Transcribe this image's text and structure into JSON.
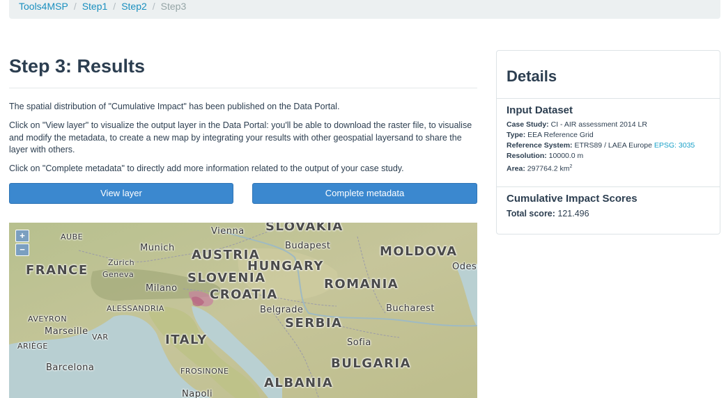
{
  "breadcrumb": {
    "items": [
      "Tools4MSP",
      "Step1",
      "Step2"
    ],
    "separator": "/",
    "current": "Step3"
  },
  "main": {
    "title": "Step 3: Results",
    "paragraphs": [
      "The spatial distribution of \"Cumulative Impact\" has been published on the Data Portal.",
      "Click on \"View layer\" to visualize the output layer in the Data Portal: you'll be able to download the raster file, to visualise and modify the metadata, to create a new map by integrating your results with other geospatial layersand to share the layer with others.",
      "Click on \"Complete metadata\" to directly add more information related to the output of your case study."
    ],
    "buttons": {
      "view_layer": "View layer",
      "complete_metadata": "Complete metadata"
    }
  },
  "map": {
    "zoom_in": "+",
    "zoom_out": "−",
    "labels": {
      "aube": "AUBE",
      "france": "FRANCE",
      "zurich": "Zurich",
      "geneva": "Geneva",
      "munich": "Munich",
      "vienna": "Vienna",
      "slovakia": "SLOVAKIA",
      "austria": "AUSTRIA",
      "budapest": "Budapest",
      "hungary": "HUNGARY",
      "moldova": "MOLDOVA",
      "odessa": "Odess",
      "slovenia": "SLOVENIA",
      "milano": "Milano",
      "croatia": "CROATIA",
      "romania": "ROMANIA",
      "alessandria": "ALESSANDRIA",
      "belgrade": "Belgrade",
      "bucharest": "Bucharest",
      "aveyron": "AVEYRON",
      "marseille": "Marseille",
      "var": "VAR",
      "serbia": "SERBIA",
      "italy": "ITALY",
      "ariege": "ARIÈGE",
      "sofia": "Sofia",
      "barcelona": "Barcelona",
      "bulgaria": "BULGARIA",
      "frosinone": "FROSINONE",
      "albania": "ALBANIA",
      "napoli": "Napoli"
    }
  },
  "details": {
    "title": "Details",
    "input_dataset": {
      "heading": "Input Dataset",
      "case_study_label": "Case Study:",
      "case_study_value": "CI - AIR assessment 2014 LR",
      "type_label": "Type:",
      "type_value": "EEA Reference Grid",
      "ref_system_label": "Reference System:",
      "ref_system_value": "ETRS89 / LAEA Europe",
      "ref_system_link": "EPSG: 3035",
      "resolution_label": "Resolution:",
      "resolution_value": "10000.0 m",
      "area_label": "Area:",
      "area_value": "297764.2 km",
      "area_sup": "2"
    },
    "scores": {
      "heading": "Cumulative Impact Scores",
      "total_label": "Total score:",
      "total_value": "121.496"
    }
  },
  "colors": {
    "accent": "#3b88cf",
    "link": "#18a0c8",
    "text": "#2c3e50"
  }
}
